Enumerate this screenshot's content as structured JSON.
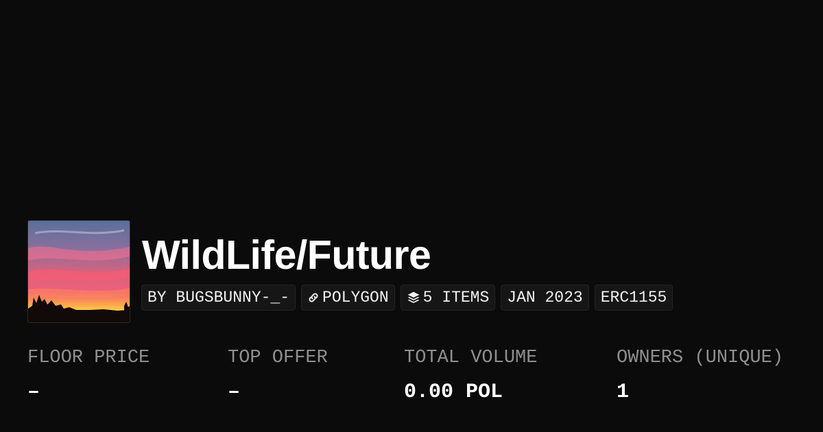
{
  "collection": {
    "title": "WildLife/Future",
    "thumbnail_alt": "sunset sky over tree silhouettes",
    "tags": [
      {
        "label": "BY BUGSBUNNY-_-",
        "icon": null
      },
      {
        "label": "POLYGON",
        "icon": "link-icon"
      },
      {
        "label": "5 ITEMS",
        "icon": "layers-icon"
      },
      {
        "label": "JAN 2023",
        "icon": null
      },
      {
        "label": "ERC1155",
        "icon": null
      }
    ]
  },
  "stats": [
    {
      "label": "FLOOR PRICE",
      "value": "–"
    },
    {
      "label": "TOP OFFER",
      "value": "–"
    },
    {
      "label": "TOTAL VOLUME",
      "value": "0.00 POL"
    },
    {
      "label": "OWNERS (UNIQUE)",
      "value": "1"
    }
  ],
  "colors": {
    "background": "#0b0b0b",
    "tag_background": "#161616",
    "label_gray": "#8f8f8f",
    "text": "#ffffff"
  }
}
